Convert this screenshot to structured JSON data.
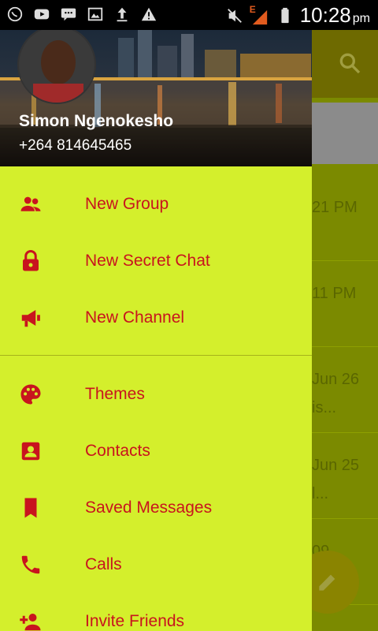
{
  "status_bar": {
    "time": "10:28",
    "ampm": "pm",
    "icons_left": [
      "whatsapp-icon",
      "youtube-icon",
      "chat-icon",
      "image-icon",
      "upload-icon",
      "warning-icon"
    ],
    "icons_right": [
      "mute-icon",
      "signal-icon",
      "battery-icon"
    ],
    "network_label": "E"
  },
  "drawer": {
    "user_name": "Simon Ngenokesho",
    "user_phone": "+264 814645465",
    "items": [
      {
        "label": "New Group",
        "icon": "group-icon"
      },
      {
        "label": "New Secret Chat",
        "icon": "lock-icon"
      },
      {
        "label": "New Channel",
        "icon": "megaphone-icon"
      },
      {
        "label": "Themes",
        "icon": "palette-icon"
      },
      {
        "label": "Contacts",
        "icon": "contacts-icon"
      },
      {
        "label": "Saved Messages",
        "icon": "bookmark-icon"
      },
      {
        "label": "Calls",
        "icon": "phone-icon"
      },
      {
        "label": "Invite Friends",
        "icon": "add-person-icon"
      }
    ]
  },
  "background_chats": [
    {
      "time": "21 PM",
      "sub": ""
    },
    {
      "time": "11 PM",
      "sub": ""
    },
    {
      "time": "Jun 26",
      "sub": "is..."
    },
    {
      "time": "Jun 25",
      "sub": "l..."
    },
    {
      "time": "09",
      "sub": ""
    }
  ],
  "colors": {
    "drawer_bg": "#d4ef2c",
    "accent_text": "#c8141e",
    "overlay_bg": "#7b8a00"
  }
}
